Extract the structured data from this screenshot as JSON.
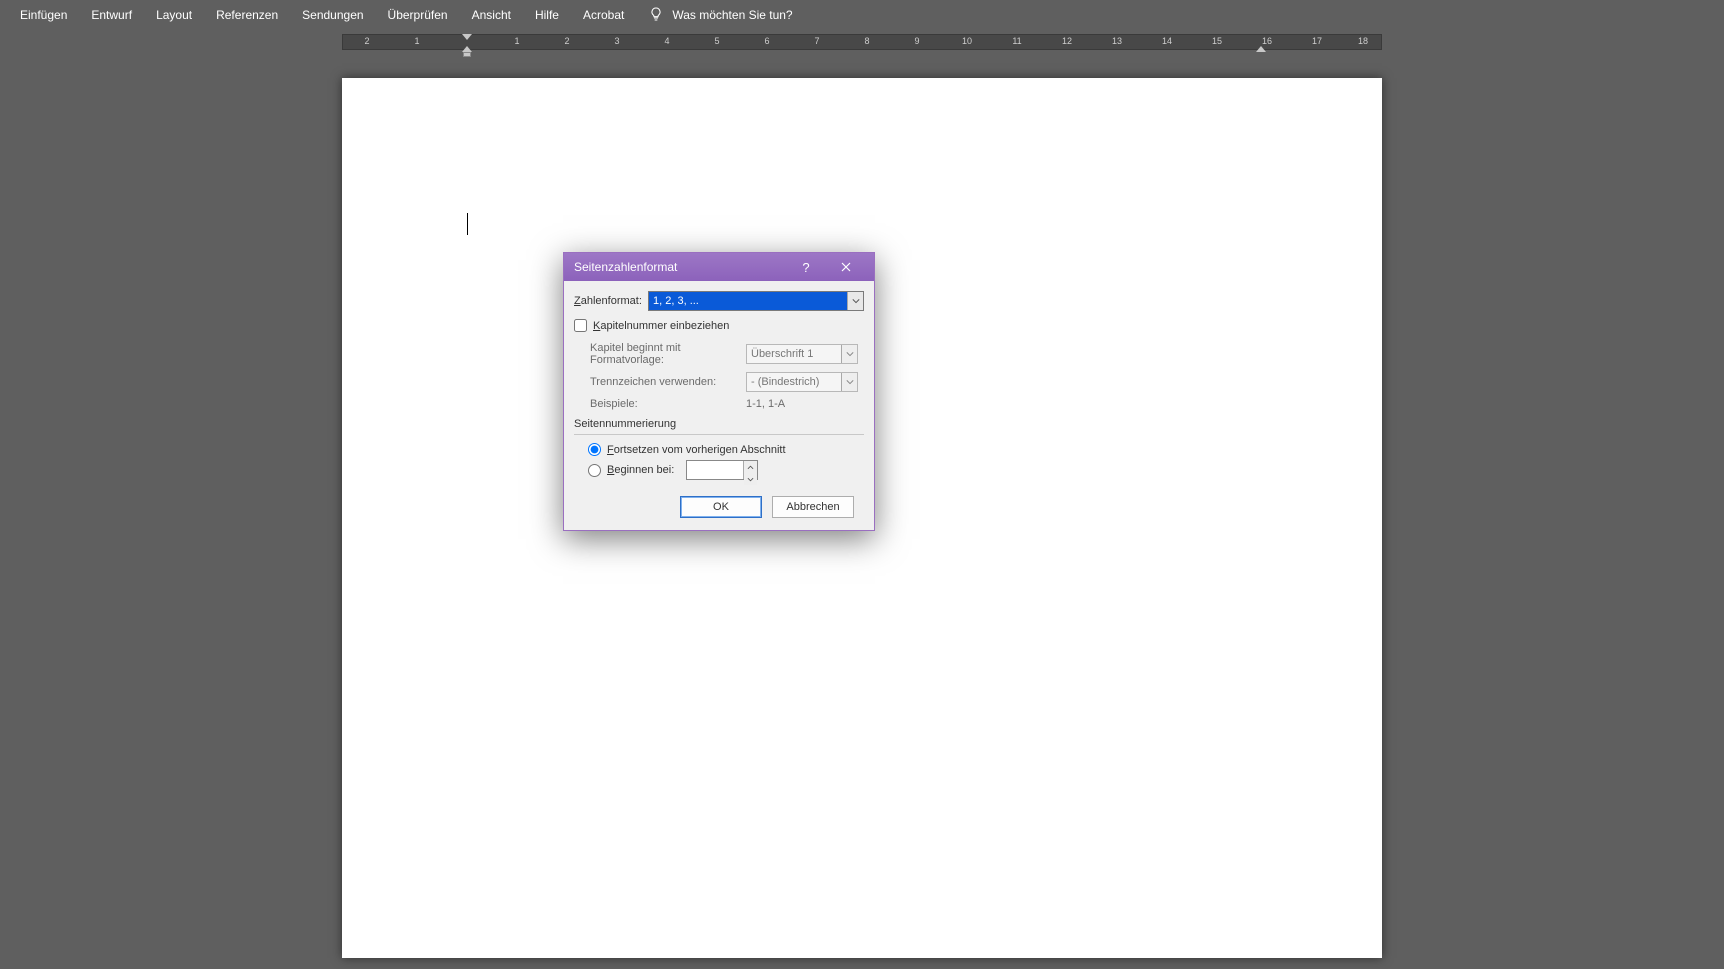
{
  "ribbon": {
    "tabs": [
      "Einfügen",
      "Entwurf",
      "Layout",
      "Referenzen",
      "Sendungen",
      "Überprüfen",
      "Ansicht",
      "Hilfe",
      "Acrobat"
    ],
    "tell_me": "Was möchten Sie tun?"
  },
  "ruler": {
    "marks": [
      "2",
      "1",
      "",
      "1",
      "2",
      "3",
      "4",
      "5",
      "6",
      "7",
      "8",
      "9",
      "10",
      "11",
      "12",
      "13",
      "14",
      "15",
      "16",
      "17",
      "18"
    ]
  },
  "dialog": {
    "title": "Seitenzahlenformat",
    "number_format_label": "Zahlenformat:",
    "number_format_value": "1, 2, 3, ...",
    "include_chapter_label": "Kapitelnummer einbeziehen",
    "chapter_style_label": "Kapitel beginnt mit Formatvorlage:",
    "chapter_style_value": "Überschrift 1",
    "separator_label": "Trennzeichen verwenden:",
    "separator_value": "-     (Bindestrich)",
    "examples_label": "Beispiele:",
    "examples_value": "1-1, 1-A",
    "numbering_group": "Seitennummerierung",
    "continue_label": "Fortsetzen vom vorherigen Abschnitt",
    "start_at_label": "Beginnen bei:",
    "start_at_value": "",
    "ok": "OK",
    "cancel": "Abbrechen"
  }
}
